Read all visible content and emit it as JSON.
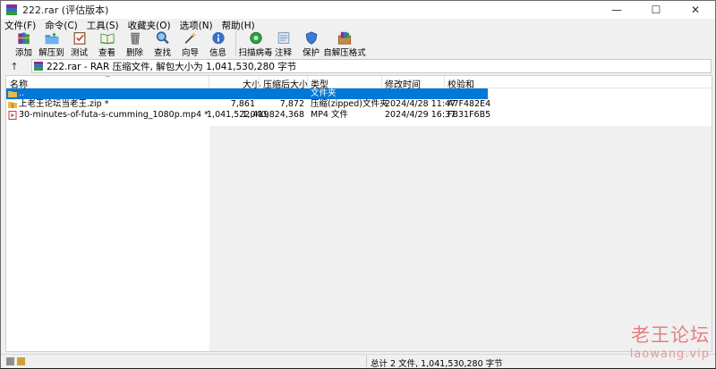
{
  "window": {
    "title": "222.rar (评估版本)",
    "controls": {
      "minimize": "—",
      "maximize": "☐",
      "close": "✕"
    }
  },
  "menubar": {
    "items": [
      {
        "label": "文件(F)"
      },
      {
        "label": "命令(C)"
      },
      {
        "label": "工具(S)"
      },
      {
        "label": "收藏夹(O)"
      },
      {
        "label": "选项(N)"
      },
      {
        "label": "帮助(H)"
      }
    ]
  },
  "toolbar": {
    "buttons": [
      {
        "id": "add",
        "label": "添加",
        "icon": "books-add-icon"
      },
      {
        "id": "extract",
        "label": "解压到",
        "icon": "folder-extract-icon"
      },
      {
        "id": "test",
        "label": "测试",
        "icon": "clipboard-check-icon"
      },
      {
        "id": "view",
        "label": "查看",
        "icon": "book-view-icon"
      },
      {
        "id": "delete",
        "label": "删除",
        "icon": "trash-icon"
      },
      {
        "id": "find",
        "label": "查找",
        "icon": "magnifier-icon"
      },
      {
        "id": "wizard",
        "label": "向导",
        "icon": "magic-wand-icon"
      },
      {
        "id": "info",
        "label": "信息",
        "icon": "info-icon"
      },
      {
        "id": "virus",
        "label": "扫描病毒",
        "icon": "virus-scan-icon"
      },
      {
        "id": "comment",
        "label": "注释",
        "icon": "comment-icon"
      },
      {
        "id": "protect",
        "label": "保护",
        "icon": "shield-icon"
      },
      {
        "id": "sfx",
        "label": "自解压格式",
        "icon": "sfx-box-icon"
      }
    ]
  },
  "address": {
    "up_label": "↑",
    "text": "222.rar - RAR 压缩文件, 解包大小为 1,041,530,280 字节"
  },
  "columns": [
    {
      "id": "name",
      "label": "名称"
    },
    {
      "id": "size",
      "label": "大小"
    },
    {
      "id": "packed",
      "label": "压缩后大小"
    },
    {
      "id": "type",
      "label": "类型"
    },
    {
      "id": "modified",
      "label": "修改时间"
    },
    {
      "id": "crc",
      "label": "校验和"
    }
  ],
  "rows": [
    {
      "name": "..",
      "size": "",
      "packed": "",
      "type": "文件夹",
      "modified": "",
      "crc": "",
      "icon": "folder-up-icon",
      "selected": true
    },
    {
      "name": "上老王论坛当老王.zip *",
      "size": "7,861",
      "packed": "7,872",
      "type": "压缩(zipped)文件夹",
      "modified": "2024/4/28 11:47",
      "crc": "A7F482E4",
      "icon": "zip-folder-icon",
      "selected": false
    },
    {
      "name": "30-minutes-of-futa-s-cumming_1080p.mp4 *",
      "size": "1,041,522,419",
      "packed": "1,040,824,368",
      "type": "MP4 文件",
      "modified": "2024/4/29 16:37",
      "crc": "FB31F6B5",
      "icon": "video-file-icon",
      "selected": false
    }
  ],
  "status": {
    "text": "总计 2 文件, 1,041,530,280 字节"
  },
  "watermark": {
    "name": "老王论坛",
    "url": "laowang.vip"
  }
}
